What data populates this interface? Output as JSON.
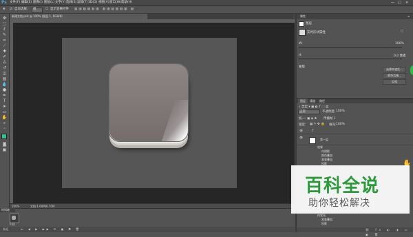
{
  "app": {
    "logo": "Ps",
    "menu": [
      "文件(F)",
      "编辑(E)",
      "图像(I)",
      "图层(L)",
      "文字(Y)",
      "选择(S)",
      "滤镜(T)",
      "3D(D)",
      "视图(V)",
      "窗口(W)",
      "帮助(H)"
    ],
    "window_controls": [
      "—",
      "□",
      "✕"
    ]
  },
  "options_bar": {
    "auto_select_label": "自动选择:",
    "auto_select_value": "组",
    "show_transform": "显示变换控件"
  },
  "document": {
    "tab_title": "新建文档.psd @ 100% (图层 1, RGB/8)",
    "status_zoom": "100%",
    "status_doc": "文档:1.60M/6.70M"
  },
  "timeline": {
    "tab_label": "时间轴",
    "frame_time": "0 秒",
    "controls_label": "永远"
  },
  "properties_panel": {
    "tabs": [
      "属性"
    ],
    "section": "图层",
    "layer_name": "实时形状属性",
    "row1_label": "W:",
    "row1_value": "100%",
    "row2_label": "H:",
    "row2_value": "0.0 像素",
    "row3_label": "蒙版",
    "buttons": [
      "选择并遮住...",
      "颜色范围...",
      "反相"
    ]
  },
  "layers_panel": {
    "tabs": [
      "图层",
      "通道",
      "路径"
    ],
    "blend_mode": "正常",
    "opacity_label": "不透明度:",
    "opacity_value": "100%",
    "fill_label": "填充:",
    "fill_value": "100%",
    "lock_label": "锁定:",
    "unify_label": "传播帧 1",
    "rows": [
      {
        "name": "T"
      },
      {
        "name": "第一层"
      },
      {
        "name": "效果"
      },
      {
        "name": "内阴影"
      },
      {
        "name": "颜色叠加"
      },
      {
        "name": "渐变叠加"
      },
      {
        "name": "投影"
      },
      {
        "name": "内发光"
      },
      {
        "name": "渐变叠加"
      },
      {
        "name": "投影"
      }
    ]
  },
  "watermark": {
    "title": "百科全说",
    "subtitle": "助你轻松解决"
  },
  "colors": {
    "foreground": "#2ec48f",
    "background": "#ffffff",
    "accent_green": "#2a9a3a"
  }
}
